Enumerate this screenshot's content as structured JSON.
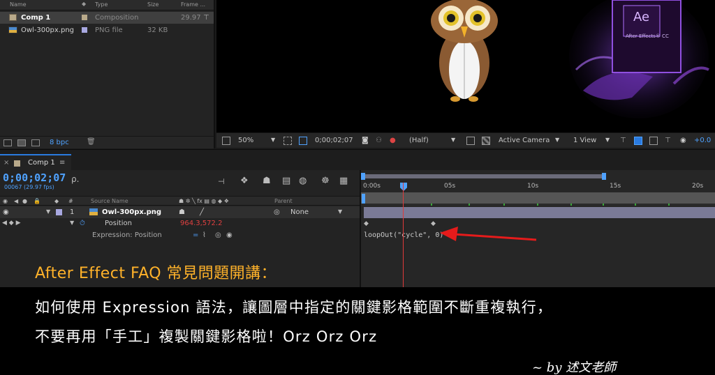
{
  "project_panel": {
    "columns": {
      "name": "Name",
      "type": "Type",
      "size": "Size",
      "frame_rate": "Frame ..."
    },
    "items": [
      {
        "name": "Comp 1",
        "type": "Composition",
        "size": "",
        "frame_rate": "29.97",
        "label_color": "#b8a98a"
      },
      {
        "name": "Owl-300px.png",
        "type": "PNG file",
        "size": "32 KB",
        "frame_rate": "",
        "label_color": "#a8a8e0"
      }
    ],
    "bit_depth": "8 bpc"
  },
  "viewer": {
    "ae_logo": "Ae",
    "ae_product": "After Effects® CC",
    "toolbar": {
      "zoom": "50%",
      "timecode": "0;00;02;07",
      "resolution": "(Half)",
      "camera": "Active Camera",
      "views": "1 View",
      "exposure": "+0.0"
    }
  },
  "timeline": {
    "tab_label": "Comp 1",
    "current_time": "0;00;02;07",
    "frame_info": "00067 (29.97 fps)",
    "search_placeholder": "ρ.",
    "columns": {
      "source_name": "Source Name",
      "parent": "Parent"
    },
    "layer": {
      "index": "1",
      "name": "Owl-300px.png",
      "parent": "None"
    },
    "position": {
      "label": "Position",
      "value": "964.3,572.2"
    },
    "expression": {
      "label": "Expression: Position",
      "code": "loopOut(\"cycle\", 0)"
    },
    "ruler_labels": [
      "0:00s",
      "05s",
      "10s",
      "15s",
      "20s"
    ]
  },
  "caption": {
    "title": "After Effect FAQ 常見問題開講：",
    "line1": "如何使用 Expression 語法，讓圖層中指定的關鍵影格範圍不斷重複執行，",
    "line2": "不要再用「手工」複製關鍵影格啦！Orz Orz Orz",
    "byline": "~ by 述文老師"
  },
  "colors": {
    "accent_blue": "#4fa2ff",
    "caption_orange": "#ffb22a",
    "playhead_red": "#e03a3a",
    "arrow_red": "#e51b1b"
  }
}
